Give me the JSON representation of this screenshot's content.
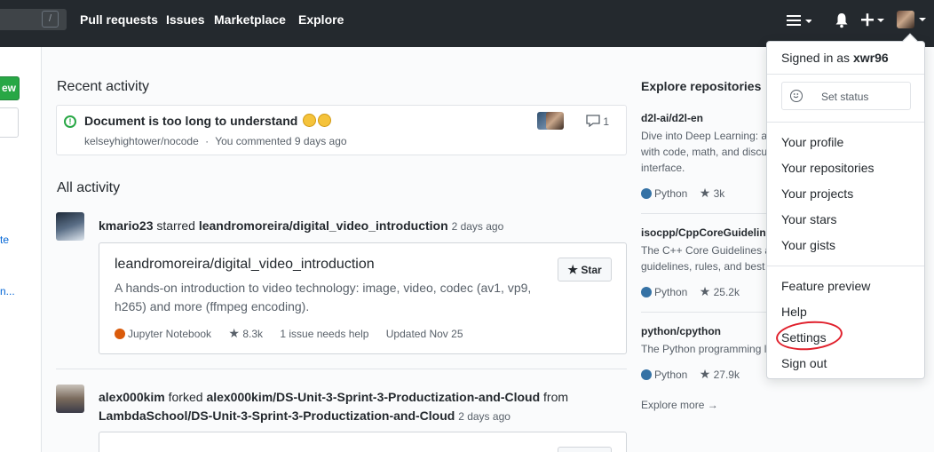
{
  "header": {
    "search_shortcut": "/",
    "nav": [
      "Pull requests",
      "Issues",
      "Marketplace",
      "Explore"
    ]
  },
  "sidebar": {
    "new_button": "ew",
    "link1": "te",
    "link2": "n..."
  },
  "recent": {
    "heading": "Recent activity",
    "title": "Document is too long to understand",
    "repo": "kelseyhightower/nocode",
    "separator": "·",
    "meta": "You commented 9 days ago",
    "comments": "1"
  },
  "all_activity": {
    "heading": "All activity",
    "item1": {
      "actor": "kmario23",
      "action": "starred",
      "target": "leandromoreira/digital_video_introduction",
      "time": "2 days ago",
      "card_title": "leandromoreira/digital_video_introduction",
      "card_desc": "A hands-on introduction to video technology: image, video, codec (av1, vp9, h265) and more (ffmpeg encoding).",
      "language": "Jupyter Notebook",
      "language_color": "#DA5B0B",
      "stars": "8.3k",
      "issues": "1 issue needs help",
      "updated": "Updated Nov 25",
      "star_label": "Star"
    },
    "item2": {
      "actor": "alex000kim",
      "action": "forked",
      "target": "alex000kim/DS-Unit-3-Sprint-3-Productization-and-Cloud",
      "from_word": "from",
      "source": "LambdaSchool/DS-Unit-3-Sprint-3-Productization-and-Cloud",
      "time": "2 days ago"
    }
  },
  "explore": {
    "heading": "Explore repositories",
    "repos": [
      {
        "name": "d2l-ai/d2l-en",
        "desc1": "Dive into Deep Learning: an",
        "desc2": "with code, math, and discu",
        "desc3": "interface.",
        "language": "Python",
        "stars": "3k"
      },
      {
        "name": "isocpp/CppCoreGuidelines",
        "desc1": "The C++ Core Guidelines a",
        "desc2": "guidelines, rules, and best p",
        "language": "Python",
        "stars": "25.2k"
      },
      {
        "name": "python/cpython",
        "desc1": "The Python programming l",
        "language": "Python",
        "stars": "27.9k"
      }
    ],
    "python_color": "#3572A5",
    "more": "Explore more →"
  },
  "dropdown": {
    "signed_in_prefix": "Signed in as",
    "username": "xwr96",
    "set_status": "Set status",
    "items_group1": [
      "Your profile",
      "Your repositories",
      "Your projects",
      "Your stars",
      "Your gists"
    ],
    "items_group2": [
      "Feature preview",
      "Help",
      "Settings",
      "Sign out"
    ],
    "highlight_color": "#e0202c"
  }
}
